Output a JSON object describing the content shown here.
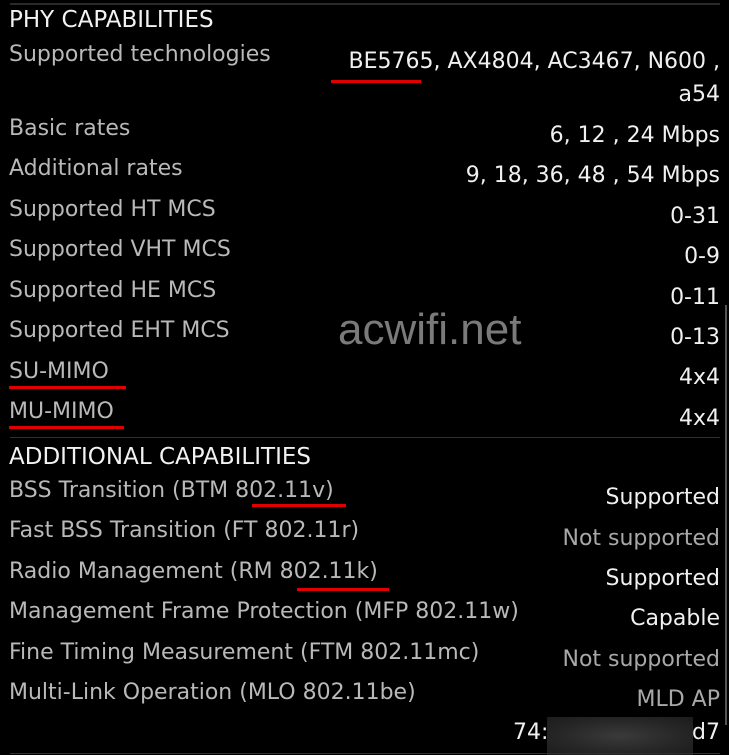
{
  "phy": {
    "title": "PHY CAPABILITIES",
    "rows": [
      {
        "label": "Supported technologies",
        "value_line1": "BE5765, AX4804, AC3467, N600 ,",
        "value_line2": "a54"
      },
      {
        "label": "Basic rates",
        "value": "6, 12 , 24 Mbps"
      },
      {
        "label": "Additional rates",
        "value": "9, 18, 36, 48 , 54 Mbps"
      },
      {
        "label": "Supported HT MCS",
        "value": "0-31"
      },
      {
        "label": "Supported VHT MCS",
        "value": "0-9"
      },
      {
        "label": "Supported HE MCS",
        "value": "0-11"
      },
      {
        "label": "Supported EHT MCS",
        "value": "0-13"
      },
      {
        "label": "SU-MIMO",
        "value": "4x4"
      },
      {
        "label": "MU-MIMO",
        "value": "4x4"
      }
    ]
  },
  "additional": {
    "title": "ADDITIONAL CAPABILITIES",
    "rows": [
      {
        "label": "BSS Transition (BTM 802.11v)",
        "value": "Supported"
      },
      {
        "label": "Fast BSS Transition (FT 802.11r)",
        "value": "Not supported"
      },
      {
        "label": "Radio Management (RM 802.11k)",
        "value": "Supported"
      },
      {
        "label": "Management Frame Protection (MFP 802.11w)",
        "value": "Capable"
      },
      {
        "label": "Fine Timing Measurement (FTM 802.11mc)",
        "value": "Not supported"
      },
      {
        "label": "Multi-Link Operation (MLO 802.11be)",
        "value": "MLD AP"
      }
    ],
    "mld_address_prefix": "74:",
    "mld_address_suffix": "d7"
  },
  "watermark": "acwifi.net",
  "annotation_color": "#e00000"
}
